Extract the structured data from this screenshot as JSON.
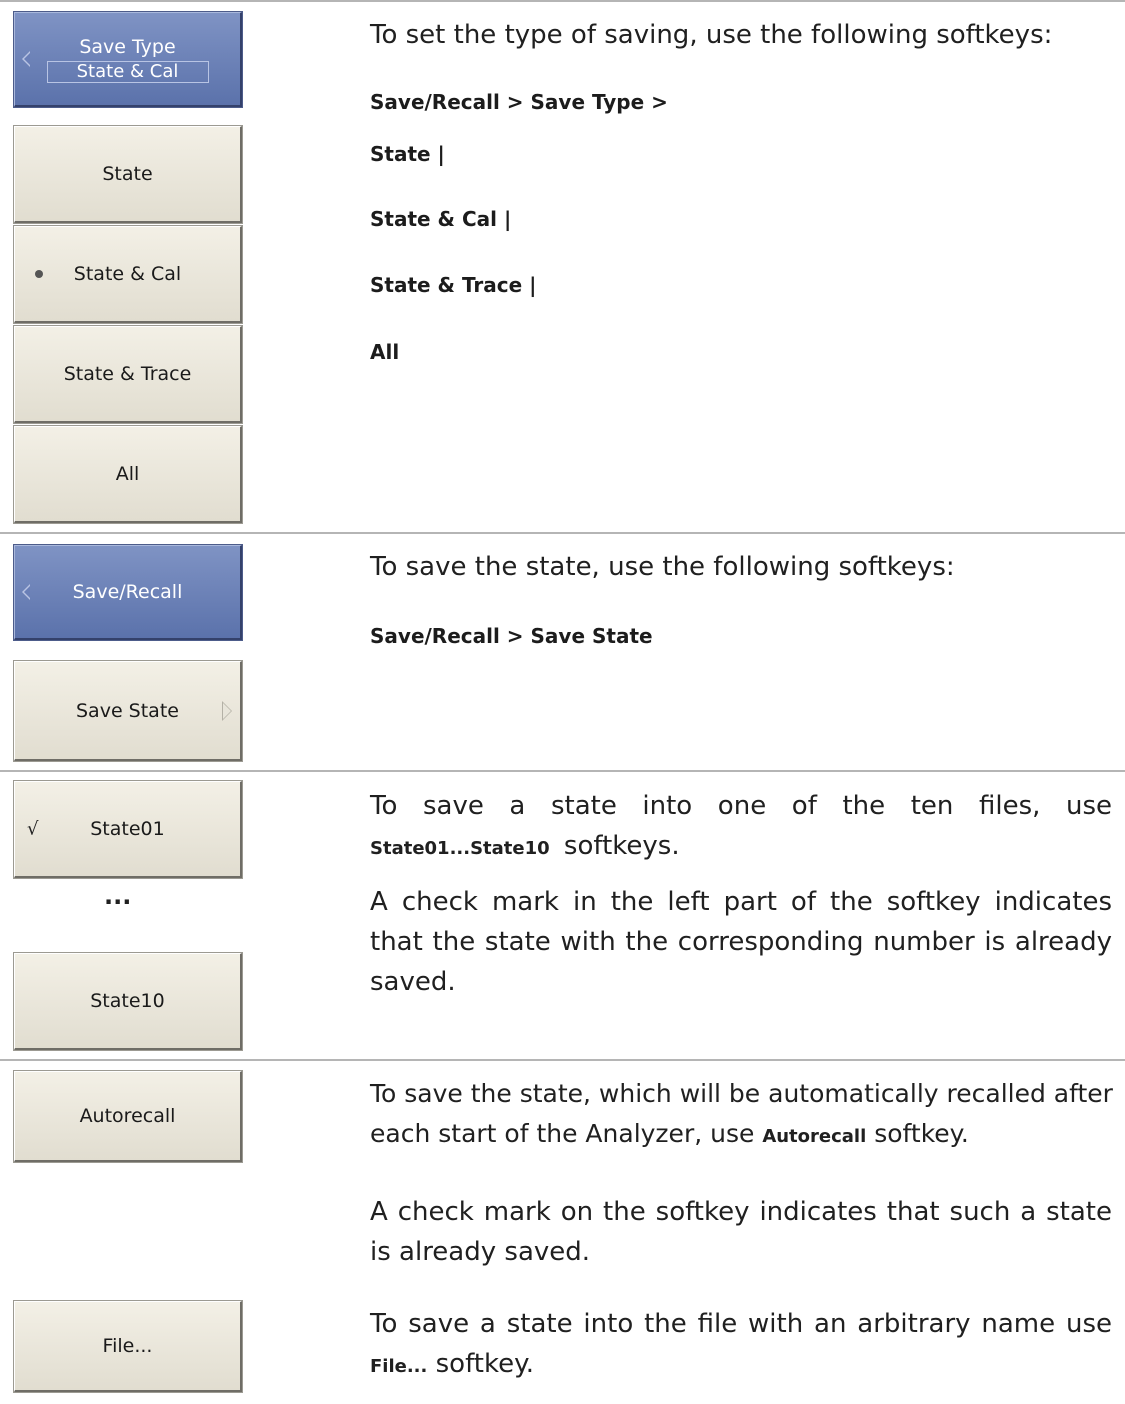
{
  "section1": {
    "header_key": {
      "title": "Save Type",
      "value": "State & Cal"
    },
    "keys": [
      "State",
      "State & Cal",
      "State & Trace",
      "All"
    ],
    "intro": "To set the type of saving, use the following softkeys:",
    "commands": [
      "Save/Recall > Save Type >",
      "State |",
      "State & Cal |",
      "State & Trace |",
      "All"
    ]
  },
  "section2": {
    "header_key": "Save/Recall",
    "key": "Save State",
    "intro": "To save the state, use the following softkeys:",
    "command": "Save/Recall > Save State"
  },
  "section3": {
    "key_first": "State01",
    "ellipsis": "...",
    "key_last": "State10",
    "para1_a": "To save a state into one of the ten files, use ",
    "para1_key": "State01...State10",
    "para1_b": " softkeys.",
    "para2": "A check mark in the left part of the softkey indicates that the state with the corresponding number is already saved."
  },
  "section4": {
    "key_autorecall": "Autorecall",
    "para1_a": "To save the state, which will be automatically recalled after each start of the Analyzer, use ",
    "para1_key": "Autorecall",
    "para1_b": " softkey.",
    "para2": "A check mark on the softkey indicates that such a state is already saved.",
    "key_file": "File...",
    "para3_a": "To save a state into the file with an arbitrary name use ",
    "para3_key": "File...",
    "para3_b": " softkey."
  },
  "colors": {
    "softkey_face": "#e8e5da",
    "softkey_blue": "#6a7fb7",
    "rule": "#b5b5b5"
  }
}
